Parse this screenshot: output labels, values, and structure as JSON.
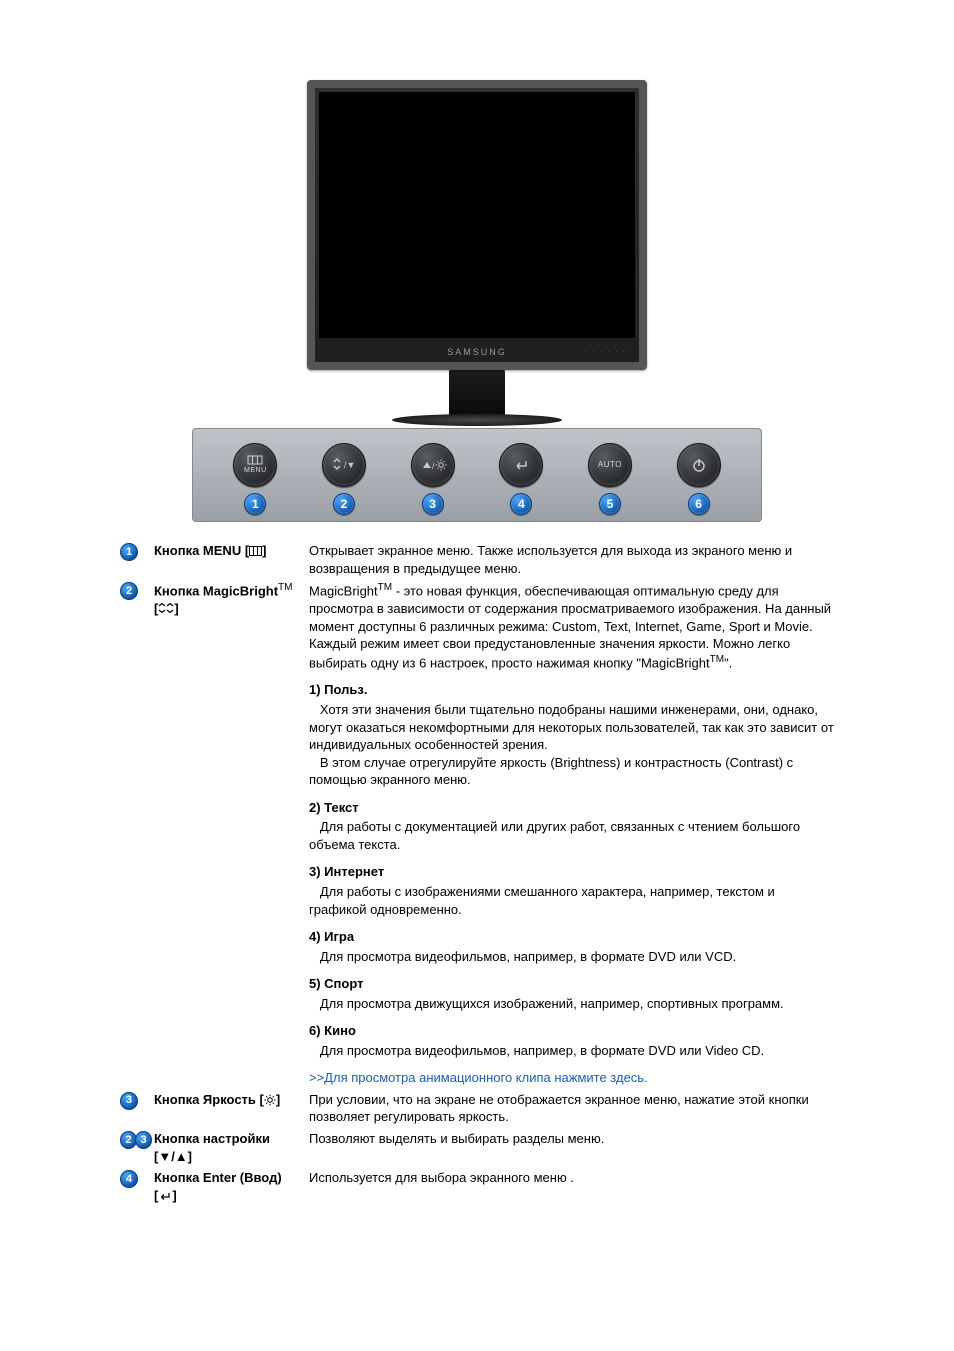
{
  "monitor_brand": "SAMSUNG",
  "panel_buttons": [
    {
      "num": "1",
      "label_line1": "",
      "label_line2": "MENU",
      "icon": "menu"
    },
    {
      "num": "2",
      "label_line1": "",
      "label_line2": "",
      "icon": "mb-down"
    },
    {
      "num": "3",
      "label_line1": "",
      "label_line2": "",
      "icon": "up-bright"
    },
    {
      "num": "4",
      "label_line1": "",
      "label_line2": "",
      "icon": "enter"
    },
    {
      "num": "5",
      "label_line1": "AUTO",
      "label_line2": "",
      "icon": "none"
    },
    {
      "num": "6",
      "label_line1": "",
      "label_line2": "",
      "icon": "power"
    }
  ],
  "rows": {
    "menu": {
      "badge": "1",
      "label": "Кнопка MENU [",
      "label_suffix": "]",
      "desc": "Открывает экранное меню. Также используется для выхода из экраного меню и возвращения в предыдущее меню."
    },
    "magicbright": {
      "badge": "2",
      "label_prefix": "Кнопка MagicBright",
      "label_bracket": "[",
      "label_bracket_close": "]",
      "desc1": "MagicBright",
      "desc2": " - это новая функция, обеспечивающая оптимальную среду для просмотра в зависимости от содержания просматриваемого изображения. На данный момент доступны 6 различных режима: Custom, Text, Internet, Game, Sport и Movie. Каждый режим имеет свои предустановленные значения яркости. Можно легко выбирать одну из 6 настроек, просто нажимая кнопку \"MagicBright",
      "desc3": "\".",
      "modes": [
        {
          "title": "1) Польз.",
          "body1": "Хотя эти значения были тщательно подобраны нашими инженерами, они, однако, могут оказаться некомфортными для некоторых пользователей, так как это зависит от индивидуальных особенностей зрения.",
          "body2": "В этом случае отрегулируйте яркость (Brightness) и контрастность (Contrast) с помощью экранного меню."
        },
        {
          "title": "2) Текст",
          "body1": "Для работы с документацией или других работ, связанных с чтением большого объема текста."
        },
        {
          "title": "3) Интернет",
          "body1": "Для работы с изображениями смешанного характера, например, текстом и графикой одновременно."
        },
        {
          "title": "4) Игра",
          "body1": "Для просмотра видеофильмов, например, в формате DVD или VCD."
        },
        {
          "title": "5) Спорт",
          "body1": "Для просмотра движущихся изображений, например, спортивных программ."
        },
        {
          "title": "6) Кино",
          "body1": "Для просмотра видеофильмов, например, в формате DVD или Video CD."
        }
      ],
      "link": ">>Для просмотра анимационного клипа нажмите здесь."
    },
    "brightness": {
      "badge": "3",
      "label": "Кнопка Яркость [",
      "label_suffix": "]",
      "desc": "При условии, что на экране не отображается экранное меню, нажатие этой кнопки позволяет регулировать яркость."
    },
    "adjust": {
      "badge1": "2",
      "badge2": "3",
      "label": "Кнопка настройки",
      "label_bracket": "[▼/▲]",
      "desc": "Позволяют выделять и выбирать разделы меню."
    },
    "enter": {
      "badge": "4",
      "label": "Кнопка Enter (Ввод)",
      "label_bracket_open": "[",
      "label_bracket_close": "]",
      "desc": "Используется для выбора экранного меню ."
    }
  },
  "tm": "TM"
}
